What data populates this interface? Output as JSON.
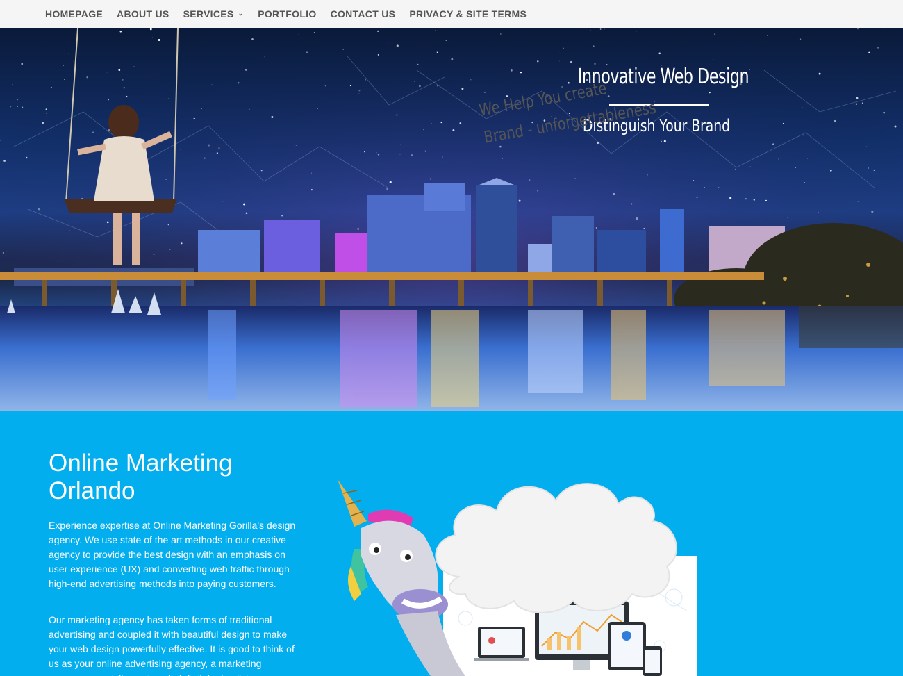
{
  "nav": {
    "items": [
      {
        "label": "HOMEPAGE"
      },
      {
        "label": "ABOUT US"
      },
      {
        "label": "SERVICES"
      },
      {
        "label": "PORTFOLIO"
      },
      {
        "label": "CONTACT US"
      },
      {
        "label": "PRIVACY & SITE TERMS"
      }
    ]
  },
  "hero": {
    "title": "Innovative Web Design",
    "subtitle": "Distinguish Your Brand"
  },
  "section": {
    "title_line1": "Online Marketing",
    "title_line2": "Orlando",
    "paragraph1": "Experience expertise at Online Marketing Gorilla's design agency. We use state of the art methods in our creative agency to provide the best design with an emphasis on user experience (UX) and converting web traffic through high-end advertising methods into paying customers.",
    "paragraph2": "Our marketing agency has taken forms of traditional advertising and coupled it with beautiful design to make your web design powerfully effective. It is good to think of us as your online advertising agency, a marketing company specially equipped at digital advertising."
  },
  "illustration": {
    "cloud_line1": "We Help You create",
    "cloud_line2": "Brand - unforgettableness"
  },
  "colors": {
    "nav_bg": "#f5f5f5",
    "nav_text": "#555555",
    "section_bg": "#03aeef",
    "text_white": "#ffffff"
  }
}
